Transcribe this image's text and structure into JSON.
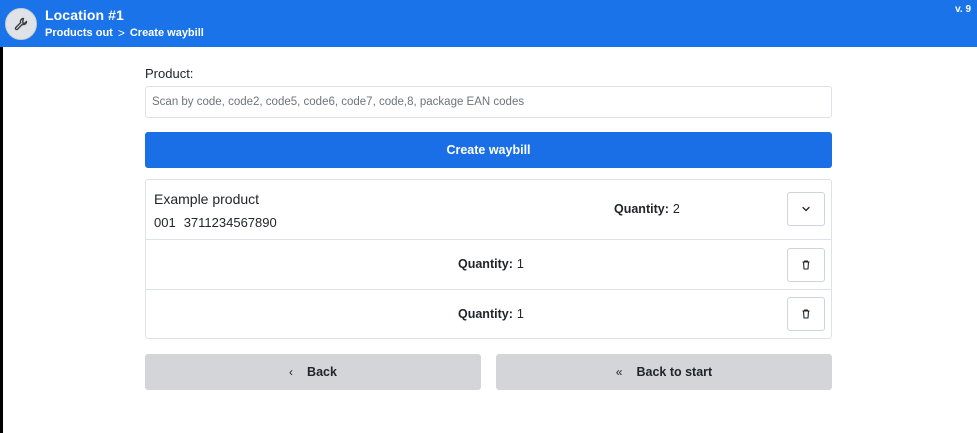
{
  "header": {
    "title": "Location #1",
    "breadcrumb": [
      "Products out",
      "Create waybill"
    ],
    "breadcrumb_separator": ">",
    "version": "v. 9",
    "logo_icon": "wrench-icon",
    "color": "#1a73e8"
  },
  "form": {
    "product_label": "Product:",
    "product_placeholder": "Scan by code, code2, code5, code6, code7, code,8, package EAN codes",
    "product_value": ""
  },
  "actions": {
    "create_label": "Create waybill",
    "back_label": "Back",
    "back_icon": "chevron-left-icon",
    "back_to_start_label": "Back to start",
    "back_to_start_icon": "double-chevron-left-icon"
  },
  "items": {
    "product": {
      "name": "Example product",
      "code": "001",
      "ean": "3711234567890",
      "quantity_label": "Quantity:",
      "quantity": "2",
      "toggle_icon": "chevron-down-icon"
    },
    "sub_rows": [
      {
        "quantity_label": "Quantity:",
        "quantity": "1",
        "action_icon": "trash-icon"
      },
      {
        "quantity_label": "Quantity:",
        "quantity": "1",
        "action_icon": "trash-icon"
      }
    ]
  }
}
